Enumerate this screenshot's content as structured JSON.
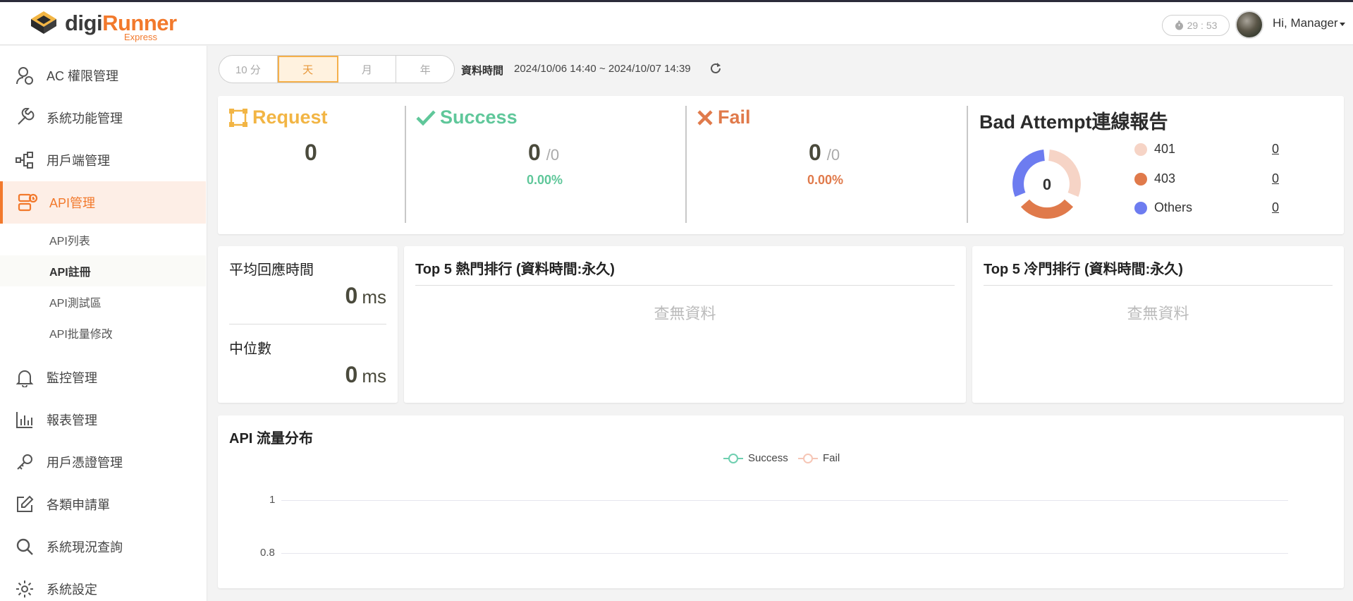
{
  "app": {
    "logo_main": "digi",
    "logo_accent": "Runner",
    "logo_sub": "Express",
    "timer": "29 : 53",
    "greeting": "Hi, Manager"
  },
  "sidebar": {
    "items": [
      {
        "label": "AC 權限管理",
        "icon": "user-permission-icon"
      },
      {
        "label": "系統功能管理",
        "icon": "wrench-icon"
      },
      {
        "label": "用戶端管理",
        "icon": "client-tree-icon"
      },
      {
        "label": "API管理",
        "icon": "api-manage-icon"
      },
      {
        "label": "監控管理",
        "icon": "bell-icon"
      },
      {
        "label": "報表管理",
        "icon": "bar-chart-icon"
      },
      {
        "label": "用戶憑證管理",
        "icon": "key-icon"
      },
      {
        "label": "各類申請單",
        "icon": "edit-icon"
      },
      {
        "label": "系統現況查詢",
        "icon": "search-icon"
      },
      {
        "label": "系統設定",
        "icon": "gear-icon"
      }
    ],
    "sub_items": [
      {
        "label": "API列表"
      },
      {
        "label": "API註冊"
      },
      {
        "label": "API測試區"
      },
      {
        "label": "API批量修改"
      }
    ]
  },
  "filter": {
    "options": [
      "10 分",
      "天",
      "月",
      "年"
    ],
    "selected": "天",
    "range_label": "資料時間",
    "range_value": "2024/10/06 14:40 ~ 2024/10/07 14:39"
  },
  "stats": {
    "request": {
      "title": "Request",
      "value": "0"
    },
    "success": {
      "title": "Success",
      "value": "0",
      "total": "/0",
      "percent": "0.00%"
    },
    "fail": {
      "title": "Fail",
      "value": "0",
      "total": "/0",
      "percent": "0.00%"
    }
  },
  "bad_attempt": {
    "title": "Bad Attempt連線報告",
    "total": "0",
    "legend": [
      {
        "label": "401",
        "value": "0",
        "color": "#f6d4c6"
      },
      {
        "label": "403",
        "value": "0",
        "color": "#e07a4b"
      },
      {
        "label": "Others",
        "value": "0",
        "color": "#6d7cf0"
      }
    ]
  },
  "response": {
    "avg_label": "平均回應時間",
    "avg_value": "0",
    "avg_unit": "ms",
    "median_label": "中位數",
    "median_value": "0",
    "median_unit": "ms"
  },
  "top5_hot": {
    "title": "Top 5 熱門排行 (資料時間:永久)",
    "empty": "查無資料"
  },
  "top5_cold": {
    "title": "Top 5 冷門排行 (資料時間:永久)",
    "empty": "查無資料"
  },
  "traffic": {
    "title": "API 流量分布",
    "legend": [
      {
        "label": "Success",
        "color": "#6fcfb0"
      },
      {
        "label": "Fail",
        "color": "#f6c6b6"
      }
    ],
    "y_ticks": [
      "1",
      "0.8"
    ]
  },
  "colors": {
    "accent": "#f2792c",
    "request": "#f2b544",
    "success": "#5fc79a",
    "fail": "#e07a4b"
  }
}
